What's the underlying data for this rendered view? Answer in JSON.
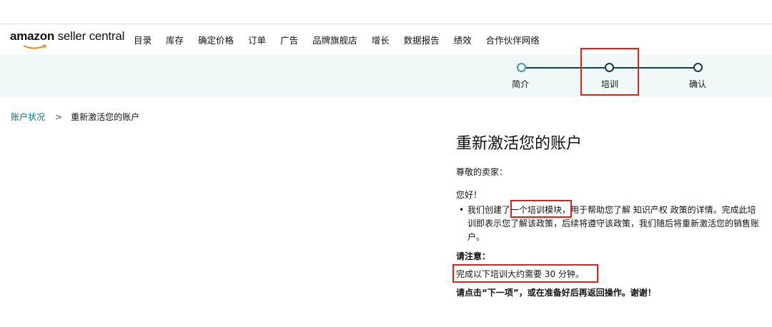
{
  "logo": {
    "brand": "amazon",
    "product": "seller central"
  },
  "nav": {
    "items": [
      "目录",
      "库存",
      "确定价格",
      "订单",
      "广告",
      "品牌旗舰店",
      "增长",
      "数据报告",
      "绩效",
      "合作伙伴网络"
    ]
  },
  "progress": {
    "steps": [
      {
        "label": "简介",
        "state": "done"
      },
      {
        "label": "培训",
        "state": "current"
      },
      {
        "label": "确认",
        "state": "todo"
      }
    ]
  },
  "breadcrumb": {
    "parent": "账户状况",
    "separator": ">",
    "current": "重新激活您的账户"
  },
  "main": {
    "title": "重新激活您的账户",
    "salutation": "尊敬的卖家：",
    "greeting": "您好！",
    "bullet_part1": "我们创建了",
    "bullet_highlight": "一个培训模块，",
    "bullet_part2": "用于帮助您了解 知识产权 政策的详情。完成此培训即表示您了解该政策，后续将遵守该政策，我们随后将重新激活您的销售账户。",
    "note_title": "请注意：",
    "note_time": "完成以下培训大约需要 30 分钟。",
    "note_action": "请点击“下一项”，或在准备好后再返回操作。谢谢！"
  },
  "colors": {
    "accent": "#0f3f47",
    "link": "#007185",
    "highlight_box": "#d9231f",
    "band": "#f0f8f8"
  }
}
